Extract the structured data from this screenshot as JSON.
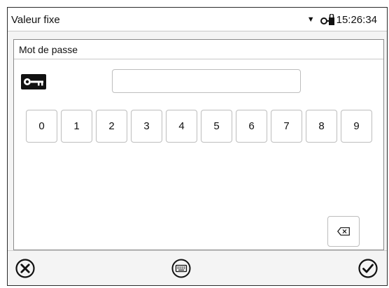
{
  "titlebar": {
    "title": "Valeur fixe",
    "time": "15:26:34",
    "dropdown_icon": "caret-down-icon",
    "lock_icon": "key-lock-icon"
  },
  "dialog": {
    "title": "Mot de passe",
    "password": {
      "value": "",
      "placeholder": ""
    },
    "key_icon": "key-icon",
    "keypad": [
      "0",
      "1",
      "2",
      "3",
      "4",
      "5",
      "6",
      "7",
      "8",
      "9"
    ],
    "backspace_icon": "backspace-icon"
  },
  "footer": {
    "cancel_icon": "close-circle-icon",
    "keyboard_icon": "keyboard-icon",
    "confirm_icon": "check-circle-icon"
  }
}
